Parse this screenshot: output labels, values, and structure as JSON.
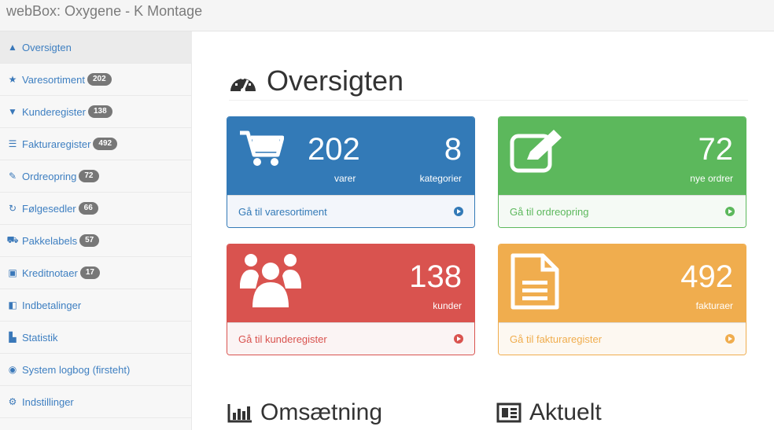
{
  "topbar": {
    "title": "webBox: Oxygene - K Montage"
  },
  "sidebar": {
    "items": [
      {
        "icon": "dashboard-icon",
        "glyph": "▲",
        "label": "Oversigten",
        "badge": "",
        "active": true
      },
      {
        "icon": "star-icon",
        "glyph": "★",
        "label": "Varesortiment",
        "badge": "202"
      },
      {
        "icon": "basket-icon",
        "glyph": "▼",
        "label": "Kunderegister",
        "badge": "138"
      },
      {
        "icon": "invoice-icon",
        "glyph": "☰",
        "label": "Fakturaregister",
        "badge": "492"
      },
      {
        "icon": "edit-icon",
        "glyph": "✎",
        "label": "Ordreopring",
        "badge": "72"
      },
      {
        "icon": "recurring-icon",
        "glyph": "↻",
        "label": "Følgesedler",
        "badge": "66"
      },
      {
        "icon": "delivery-icon",
        "glyph": "⛟",
        "label": "Pakkelabels",
        "badge": "57"
      },
      {
        "icon": "credit-note-icon",
        "glyph": "▣",
        "label": "Kreditnotaer",
        "badge": "17"
      },
      {
        "icon": "payment-icon",
        "glyph": "◧",
        "label": "Indbetalinger",
        "badge": ""
      },
      {
        "icon": "statistics-icon",
        "glyph": "▙",
        "label": "Statistik",
        "badge": ""
      },
      {
        "icon": "system-log-icon",
        "glyph": "◉",
        "label": "System logbog (firsteht)",
        "badge": ""
      },
      {
        "icon": "settings-icon",
        "glyph": "⚙",
        "label": "Indstillinger",
        "badge": ""
      }
    ]
  },
  "main": {
    "title": "Oversigten",
    "panels": {
      "products": {
        "value1": "202",
        "label1": "varer",
        "value2": "8",
        "label2": "kategorier",
        "footer": "Gå til varesortiment"
      },
      "orders": {
        "value": "72",
        "label": "nye ordrer",
        "footer": "Gå til ordreopring"
      },
      "customers": {
        "value": "138",
        "label": "kunder",
        "footer": "Gå til kunderegister"
      },
      "invoices": {
        "value": "492",
        "label": "fakturaer",
        "footer": "Gå til fakturaregister"
      }
    },
    "sections": {
      "revenue": "Omsætning",
      "news": "Aktuelt"
    }
  },
  "colors": {
    "primary": "#337ab7",
    "success": "#5cb85c",
    "danger": "#d9534f",
    "warning": "#f0ad4e"
  }
}
